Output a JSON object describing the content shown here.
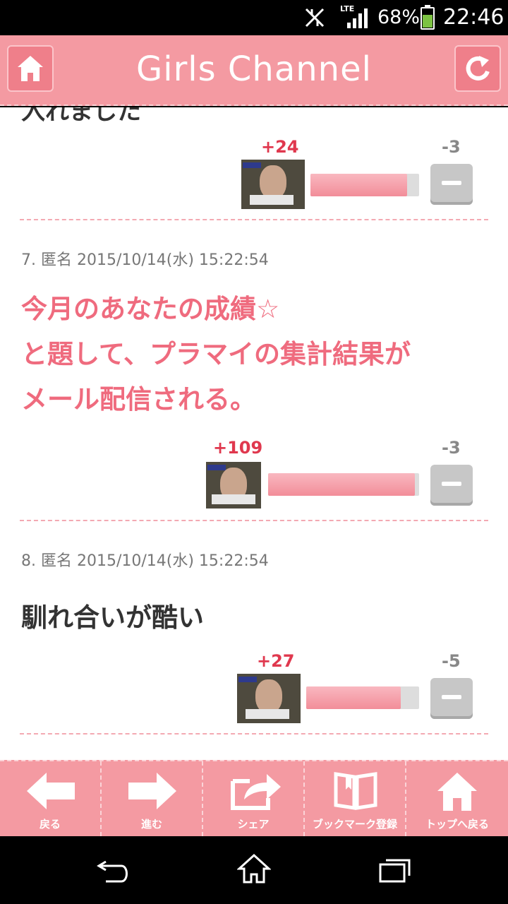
{
  "status": {
    "network": "LTE",
    "battery": "68%",
    "time": "22:46"
  },
  "header": {
    "title": "Girls Channel"
  },
  "comments": [
    {
      "cut_text": "入れました",
      "plus": "+24",
      "minus": "-3",
      "ratio": 0.89
    },
    {
      "meta": "7. 匿名 2015/10/14(水) 15:22:54",
      "lines": [
        "今月のあなたの成績☆",
        "と題して、プラマイの集計結果が",
        "メール配信される。"
      ],
      "plus": "+109",
      "minus": "-3",
      "ratio": 0.97
    },
    {
      "meta": "8. 匿名 2015/10/14(水) 15:22:54",
      "lines": [
        "馴れ合いが酷い"
      ],
      "plus": "+27",
      "minus": "-5",
      "ratio": 0.84
    }
  ],
  "toolbar": {
    "back": "戻る",
    "forward": "進む",
    "share": "シェア",
    "bookmark": "ブックマーク登録",
    "top": "トップへ戻る"
  }
}
